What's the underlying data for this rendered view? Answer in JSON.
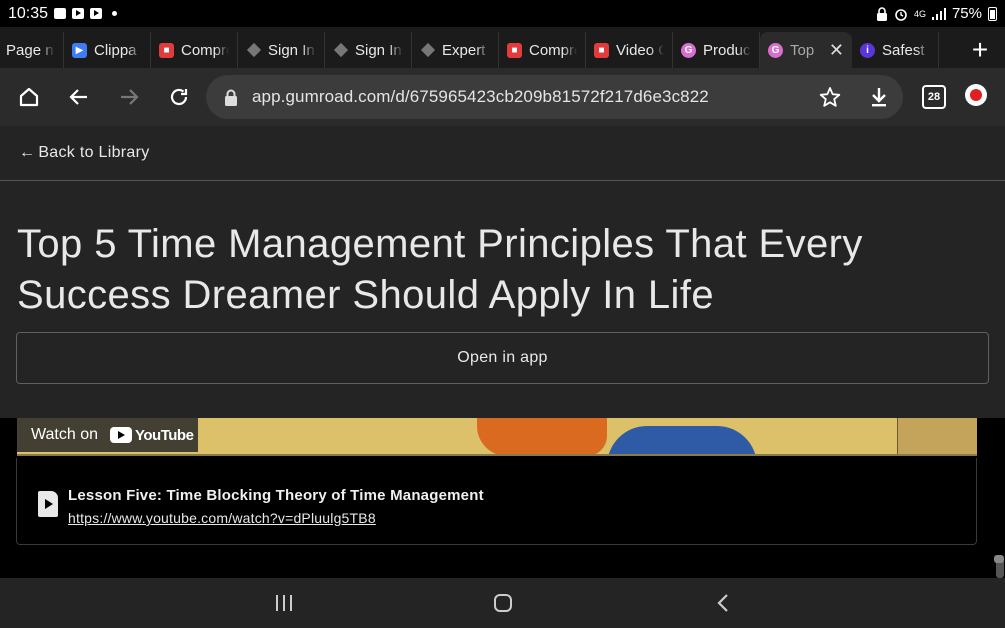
{
  "status_bar": {
    "time": "10:35",
    "network": "4G",
    "battery": "75%"
  },
  "tabs": [
    {
      "title": "Page n",
      "favicon": "page-icon"
    },
    {
      "title": "Clippa",
      "favicon": "clipchamp-icon"
    },
    {
      "title": "Compre",
      "favicon": "record-icon"
    },
    {
      "title": "Sign In",
      "favicon": "layers-icon"
    },
    {
      "title": "Sign In",
      "favicon": "layers-icon"
    },
    {
      "title": "Expert",
      "favicon": "layers-icon"
    },
    {
      "title": "Compre",
      "favicon": "record-icon"
    },
    {
      "title": "Video C",
      "favicon": "record-icon"
    },
    {
      "title": "Product",
      "favicon": "gumroad-icon"
    },
    {
      "title": "Top",
      "favicon": "gumroad-icon",
      "active": true
    },
    {
      "title": "Safest",
      "favicon": "info-icon"
    }
  ],
  "toolbar": {
    "url": "app.gumroad.com/d/675965423cb209b81572f217d6e3c822",
    "tab_count": "28"
  },
  "page": {
    "back_link": "Back to Library",
    "title": "Top 5 Time Management Principles That Every Success Dreamer Should Apply In Life",
    "open_in_app": "Open in app",
    "video": {
      "watch_on": "Watch on",
      "youtube": "YouTube"
    },
    "lesson": {
      "title": "Lesson Five: Time Blocking Theory of Time Management",
      "link": "https://www.youtube.com/watch?v=dPluulg5TB8"
    }
  },
  "colors": {
    "page_bg": "#242424",
    "content_bg": "#000000",
    "toolbar_bg": "#2b2b2b",
    "omnibox_bg": "#3c3c3c",
    "text": "#e8e8e8"
  }
}
